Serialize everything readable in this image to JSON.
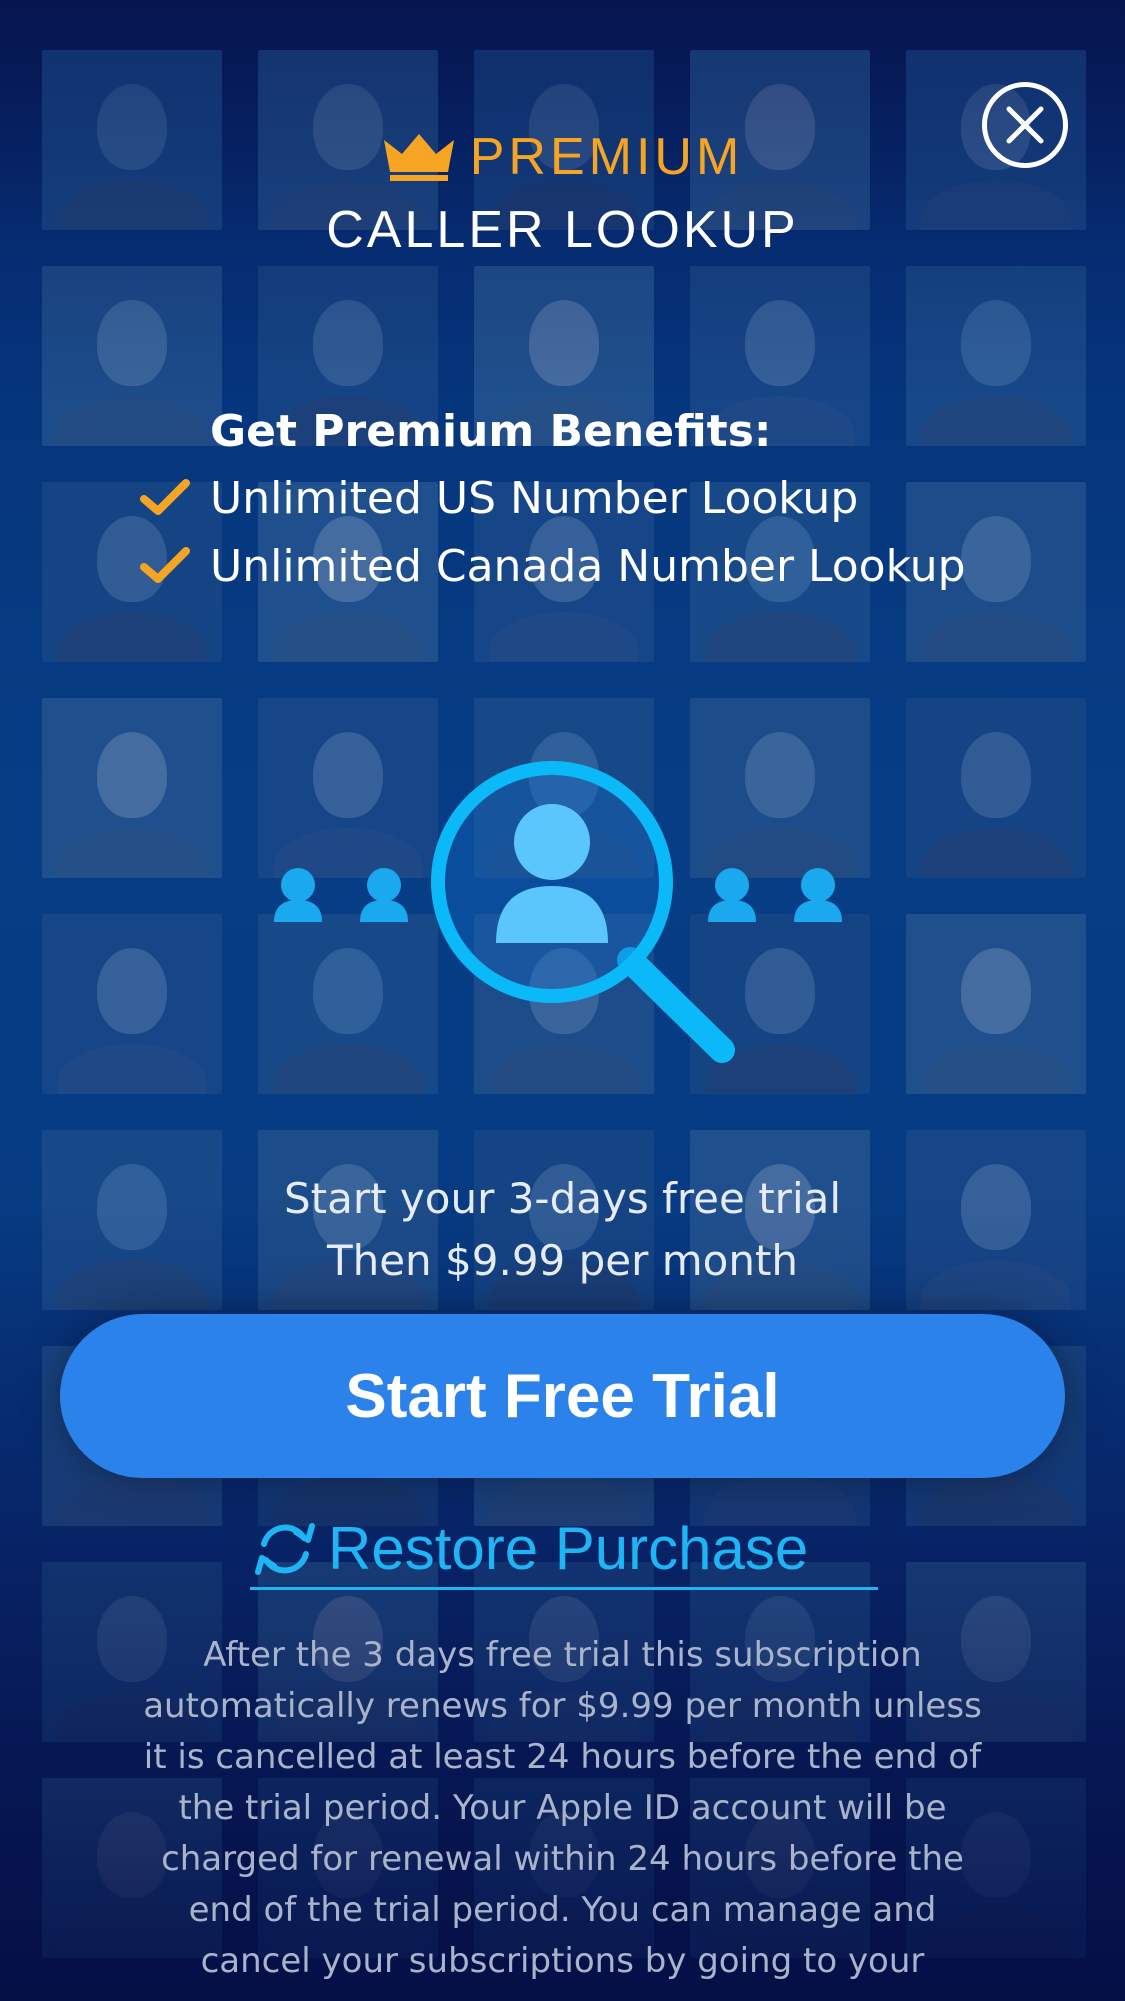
{
  "header": {
    "premium_label": "PREMIUM",
    "app_title": "CALLER LOOKUP",
    "close_icon": "close-circle-icon",
    "crown_icon": "crown-icon"
  },
  "benefits": {
    "heading": "Get Premium Benefits:",
    "items": [
      {
        "label": "Unlimited US Number Lookup",
        "icon": "checkmark-icon"
      },
      {
        "label": "Unlimited Canada Number Lookup",
        "icon": "checkmark-icon"
      }
    ]
  },
  "illustration": {
    "icon": "magnifier-person-search-icon"
  },
  "pricing": {
    "line1": "Start your 3-days free trial",
    "line2": "Then $9.99 per month"
  },
  "actions": {
    "start_trial_label": "Start Free Trial",
    "restore_label": "Restore Purchase",
    "restore_icon": "refresh-icon"
  },
  "terms": {
    "text": "After the 3 days free trial this subscription automatically renews for $9.99 per month unless it is cancelled at least 24 hours before the end of the trial period. Your Apple ID account will be charged for renewal within 24 hours before the end of the trial period. You can manage and cancel your subscriptions by going to your"
  },
  "colors": {
    "accent_orange": "#f5a523",
    "button_blue": "#2a82ea",
    "link_cyan": "#1fb4f4",
    "background_navy": "#06154f"
  }
}
